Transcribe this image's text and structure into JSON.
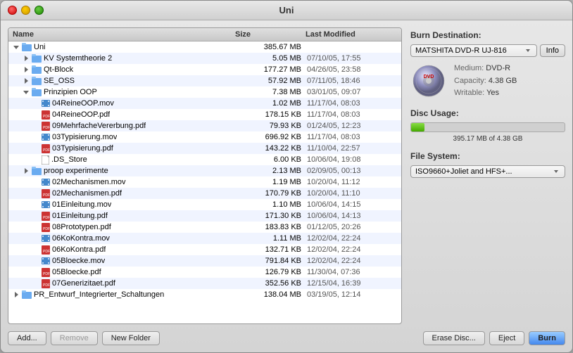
{
  "window": {
    "title": "Uni"
  },
  "header": {
    "name_col": "Name",
    "size_col": "Size",
    "modified_col": "Last Modified"
  },
  "files": [
    {
      "id": "uni",
      "name": "Uni",
      "size": "385.67 MB",
      "date": "",
      "level": 0,
      "type": "folder",
      "disclosure": "down"
    },
    {
      "id": "kv",
      "name": "KV Systemtheorie 2",
      "size": "5.05 MB",
      "date": "07/10/05, 17:55",
      "level": 1,
      "type": "folder",
      "disclosure": "right"
    },
    {
      "id": "qt",
      "name": "Qt-Block",
      "size": "177.27 MB",
      "date": "04/26/05, 23:58",
      "level": 1,
      "type": "folder",
      "disclosure": "right"
    },
    {
      "id": "seoss",
      "name": "SE_OSS",
      "size": "57.92 MB",
      "date": "07/11/05, 18:46",
      "level": 1,
      "type": "folder",
      "disclosure": "right"
    },
    {
      "id": "prinzipien",
      "name": "Prinzipien OOP",
      "size": "7.38 MB",
      "date": "03/01/05, 09:07",
      "level": 1,
      "type": "folder",
      "disclosure": "down"
    },
    {
      "id": "f1",
      "name": "04ReineOOP.mov",
      "size": "1.02 MB",
      "date": "11/17/04, 08:03",
      "level": 2,
      "type": "movie",
      "disclosure": "none"
    },
    {
      "id": "f2",
      "name": "04ReineOOP.pdf",
      "size": "178.15 KB",
      "date": "11/17/04, 08:03",
      "level": 2,
      "type": "pdf",
      "disclosure": "none"
    },
    {
      "id": "f3",
      "name": "09MehrfacheVererbung.pdf",
      "size": "79.93 KB",
      "date": "01/24/05, 12:23",
      "level": 2,
      "type": "pdf",
      "disclosure": "none"
    },
    {
      "id": "f4",
      "name": "03Typisierung.mov",
      "size": "696.92 KB",
      "date": "11/17/04, 08:03",
      "level": 2,
      "type": "movie",
      "disclosure": "none"
    },
    {
      "id": "f5",
      "name": "03Typisierung.pdf",
      "size": "143.22 KB",
      "date": "11/10/04, 22:57",
      "level": 2,
      "type": "pdf",
      "disclosure": "none"
    },
    {
      "id": "f6",
      "name": ".DS_Store",
      "size": "6.00 KB",
      "date": "10/06/04, 19:08",
      "level": 2,
      "type": "file",
      "disclosure": "none"
    },
    {
      "id": "proop",
      "name": "proop experimente",
      "size": "2.13 MB",
      "date": "02/09/05, 00:13",
      "level": 1,
      "type": "folder",
      "disclosure": "right"
    },
    {
      "id": "f7",
      "name": "02Mechanismen.mov",
      "size": "1.19 MB",
      "date": "10/20/04, 11:12",
      "level": 2,
      "type": "movie",
      "disclosure": "none"
    },
    {
      "id": "f8",
      "name": "02Mechanismen.pdf",
      "size": "170.79 KB",
      "date": "10/20/04, 11:10",
      "level": 2,
      "type": "pdf",
      "disclosure": "none"
    },
    {
      "id": "f9",
      "name": "01Einleitung.mov",
      "size": "1.10 MB",
      "date": "10/06/04, 14:15",
      "level": 2,
      "type": "movie",
      "disclosure": "none"
    },
    {
      "id": "f10",
      "name": "01Einleitung.pdf",
      "size": "171.30 KB",
      "date": "10/06/04, 14:13",
      "level": 2,
      "type": "pdf",
      "disclosure": "none"
    },
    {
      "id": "f11",
      "name": "08Prototypen.pdf",
      "size": "183.83 KB",
      "date": "01/12/05, 20:26",
      "level": 2,
      "type": "pdf",
      "disclosure": "none"
    },
    {
      "id": "f12",
      "name": "06KoKontra.mov",
      "size": "1.11 MB",
      "date": "12/02/04, 22:24",
      "level": 2,
      "type": "movie",
      "disclosure": "none"
    },
    {
      "id": "f13",
      "name": "06KoKontra.pdf",
      "size": "132.71 KB",
      "date": "12/02/04, 22:24",
      "level": 2,
      "type": "pdf",
      "disclosure": "none"
    },
    {
      "id": "f14",
      "name": "05Bloecke.mov",
      "size": "791.84 KB",
      "date": "12/02/04, 22:24",
      "level": 2,
      "type": "movie",
      "disclosure": "none"
    },
    {
      "id": "f15",
      "name": "05Bloecke.pdf",
      "size": "126.79 KB",
      "date": "11/30/04, 07:36",
      "level": 2,
      "type": "pdf",
      "disclosure": "none"
    },
    {
      "id": "f16",
      "name": "07Generizitaet.pdf",
      "size": "352.56 KB",
      "date": "12/15/04, 16:39",
      "level": 2,
      "type": "pdf",
      "disclosure": "none"
    },
    {
      "id": "pr_entwurf",
      "name": "PR_Entwurf_Integrierter_Schaltungen",
      "size": "138.04 MB",
      "date": "03/19/05, 12:14",
      "level": 0,
      "type": "folder",
      "disclosure": "right"
    }
  ],
  "bottom_buttons": {
    "add": "Add...",
    "remove": "Remove",
    "new_folder": "New Folder"
  },
  "right_panel": {
    "burn_dest_label": "Burn Destination:",
    "drive_name": "MATSHITA DVD-R UJ-816",
    "info_btn": "Info",
    "medium_label": "Medium:",
    "medium_value": "DVD-R",
    "capacity_label": "Capacity:",
    "capacity_value": "4.38 GB",
    "writable_label": "Writable:",
    "writable_value": "Yes",
    "disc_usage_label": "Disc Usage:",
    "usage_text": "395.17 MB of 4.38 GB",
    "usage_percent": 8.8,
    "file_system_label": "File System:",
    "file_system_value": "ISO9660+Joliet and HFS+..."
  },
  "bottom_right_buttons": {
    "erase": "Erase Disc...",
    "eject": "Eject",
    "burn": "Burn"
  }
}
